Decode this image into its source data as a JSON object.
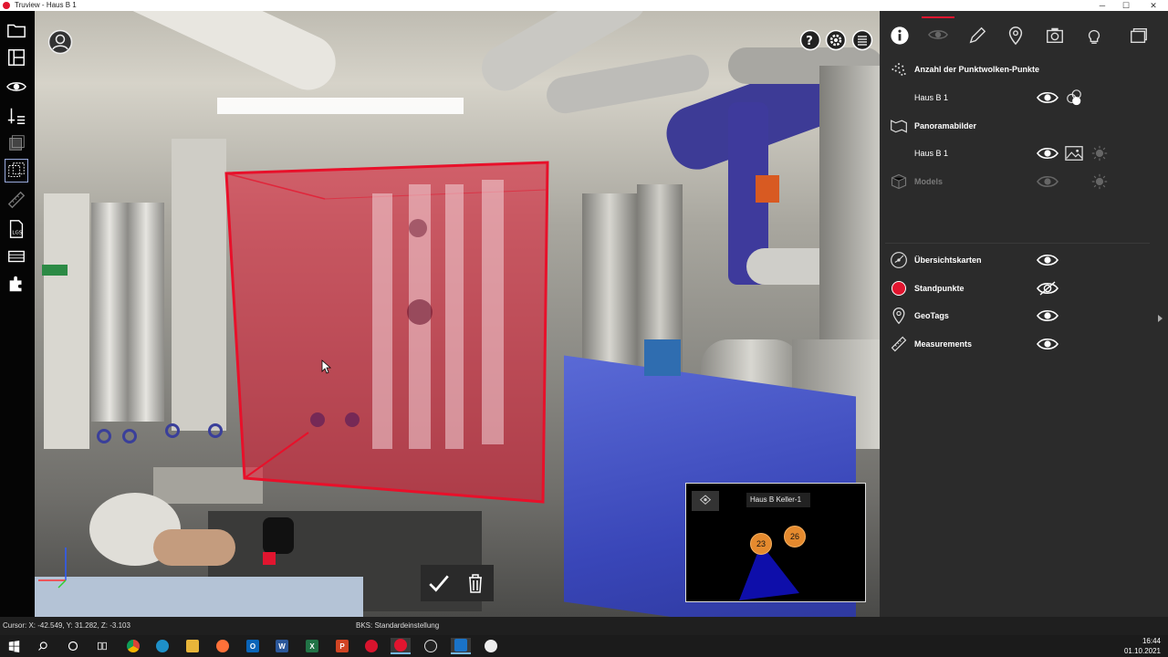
{
  "window": {
    "title": "Truview - Haus B 1",
    "minimize": "─",
    "maximize": "☐",
    "close": "✕"
  },
  "left_toolbar": {
    "items": [
      "open-folder",
      "floorplan",
      "visibility",
      "measure-axis",
      "layers",
      "limitbox",
      "ruler",
      "las-export",
      "clipping",
      "puzzle"
    ],
    "active": "limitbox"
  },
  "viewport": {
    "top_right_icons": [
      "help",
      "settings",
      "list"
    ],
    "limit_box_color": "#e1152f"
  },
  "confirm_bar": {
    "confirm_icon": "checkmark-icon",
    "delete_icon": "trash-icon"
  },
  "minimap": {
    "label": "Haus B Keller-1",
    "stations": [
      "23",
      "26"
    ]
  },
  "right_panel": {
    "tabs": [
      "info",
      "visibility",
      "edit",
      "geotag",
      "snapshot",
      "lightbulb",
      "window"
    ],
    "active_tab": "visibility",
    "rows": [
      {
        "label": "Anzahl der Punktwolken-Punkte",
        "bold": true
      },
      {
        "label": "Haus B 1",
        "sub": true
      },
      {
        "label": "Panoramabilder",
        "bold": true
      },
      {
        "label": "Haus B 1",
        "sub": true
      },
      {
        "label": "Models",
        "bold": true,
        "dim": true
      },
      {
        "label": "Übersichtskarten",
        "bold": true
      },
      {
        "label": "Standpunkte",
        "bold": true
      },
      {
        "label": "GeoTags",
        "bold": true
      },
      {
        "label": "Measurements",
        "bold": true
      }
    ]
  },
  "status": {
    "cursor": "Cursor: X: -42.549, Y: 31.282, Z: -3.103",
    "bks": "BKS: Standardeinstellung"
  },
  "taskbar": {
    "time": "16:44",
    "date": "01.10.2021",
    "apps": [
      "start",
      "search",
      "cortana",
      "taskview",
      "chrome",
      "edge",
      "explorer",
      "firefox",
      "outlook",
      "word",
      "excel",
      "powerpoint",
      "truview-red",
      "truview-active",
      "obs",
      "app-blue",
      "app-white"
    ]
  },
  "colors": {
    "accent": "#e1152f",
    "panel": "#2b2b2b",
    "station": "#e58a2e"
  }
}
